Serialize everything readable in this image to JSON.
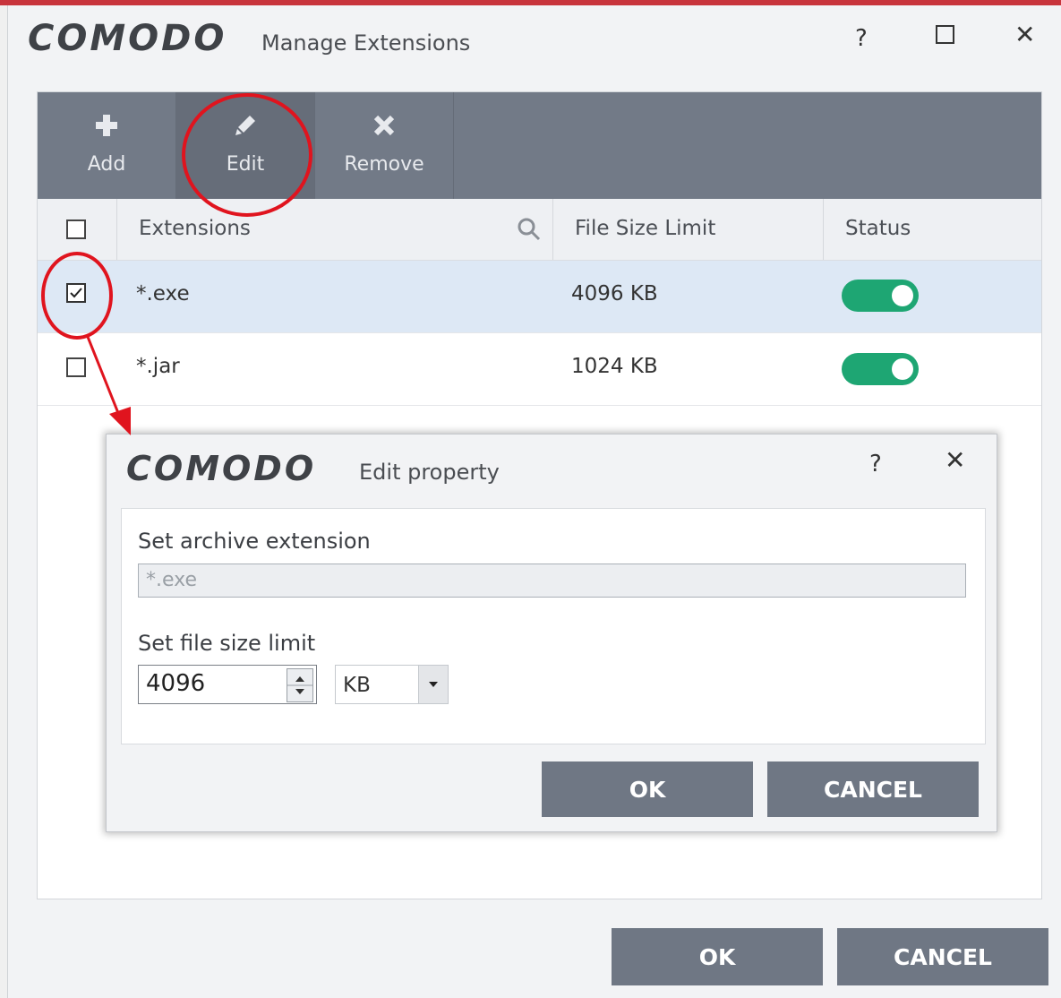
{
  "window": {
    "logo": "COMODO",
    "title": "Manage Extensions",
    "help": "?",
    "close": "✕"
  },
  "toolbar": {
    "add_label": "Add",
    "edit_label": "Edit",
    "remove_label": "Remove"
  },
  "table": {
    "columns": [
      "Extensions",
      "File Size Limit",
      "Status"
    ],
    "rows": [
      {
        "extension": "*.exe",
        "size": "4096 KB",
        "checked": true,
        "enabled": true
      },
      {
        "extension": "*.jar",
        "size": "1024 KB",
        "checked": false,
        "enabled": true
      }
    ]
  },
  "dialog": {
    "logo": "COMODO",
    "title": "Edit property",
    "help": "?",
    "close": "✕",
    "ext_label": "Set archive extension",
    "ext_value": "*.exe",
    "size_label": "Set file size limit",
    "size_value": "4096",
    "unit_value": "KB",
    "ok_label": "OK",
    "cancel_label": "CANCEL"
  },
  "footer": {
    "ok_label": "OK",
    "cancel_label": "CANCEL"
  },
  "colors": {
    "toolbar": "#727a87",
    "toggle_on": "#1ea673",
    "annotation": "#e0141e",
    "button": "#6f7784"
  }
}
